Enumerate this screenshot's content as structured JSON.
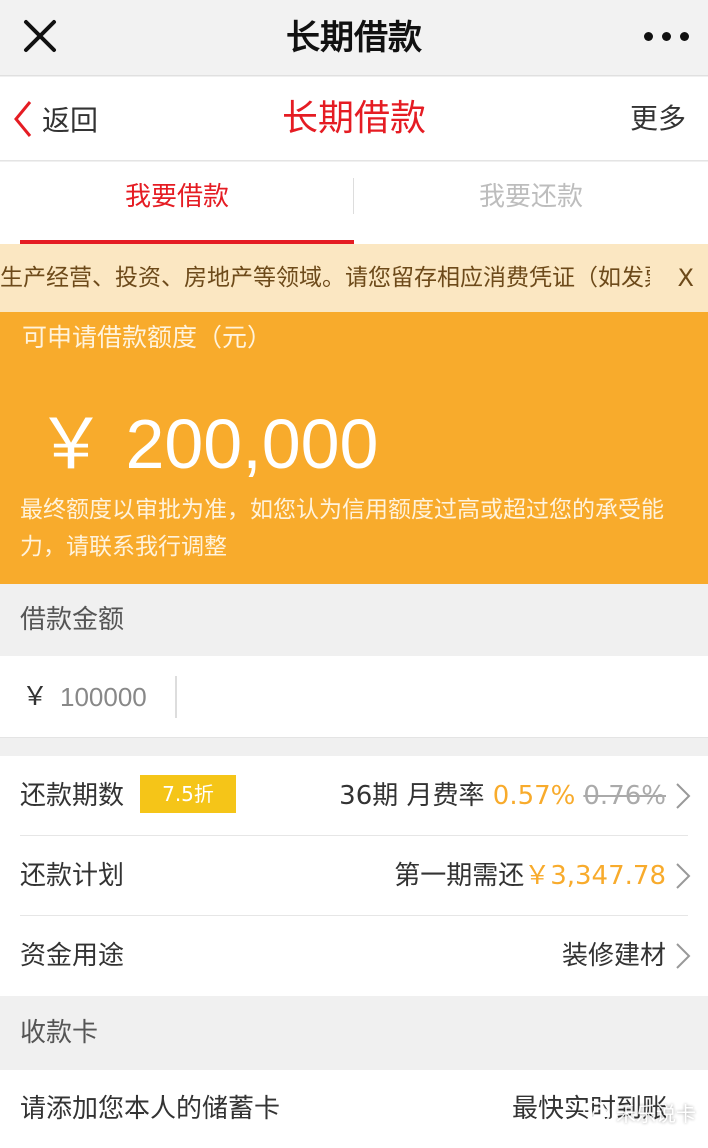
{
  "wechat_bar": {
    "title": "长期借款",
    "close_icon": "close-icon",
    "more_icon": "more-dots-icon"
  },
  "nav": {
    "back_label": "返回",
    "title": "长期借款",
    "more_label": "更多"
  },
  "tabs": [
    {
      "label": "我要借款",
      "active": true
    },
    {
      "label": "我要还款",
      "active": false
    }
  ],
  "notice": {
    "text": "生产经营、投资、房地产等领域。请您留存相应消费凭证（如发票",
    "close_label": "X"
  },
  "quota": {
    "label": "可申请借款额度（元）",
    "amount": "￥ 200,000",
    "note": "最终额度以审批为准，如您认为信用额度过高或超过您的承受能力，请联系我行调整"
  },
  "loan_amount": {
    "section_label": "借款金额",
    "currency": "￥",
    "value": "100000"
  },
  "repayment": {
    "periods_label": "还款期数",
    "discount_badge": "7.5折",
    "periods_value": "36期 月费率",
    "rate": "0.57%",
    "original_rate": "0.76%",
    "plan_label": "还款计划",
    "plan_prefix": "第一期需还",
    "plan_amount": "￥3,347.78",
    "purpose_label": "资金用途",
    "purpose_value": "装修建材"
  },
  "receiving_card": {
    "section_label": "收款卡",
    "add_label": "请添加您本人的储蓄卡",
    "speed_label": "最快实时到账"
  },
  "watermark": {
    "text": "禾乐说卡"
  },
  "colors": {
    "brand_red": "#e51c23",
    "accent_orange": "#f8ab2c",
    "badge_yellow": "#f5c518"
  }
}
